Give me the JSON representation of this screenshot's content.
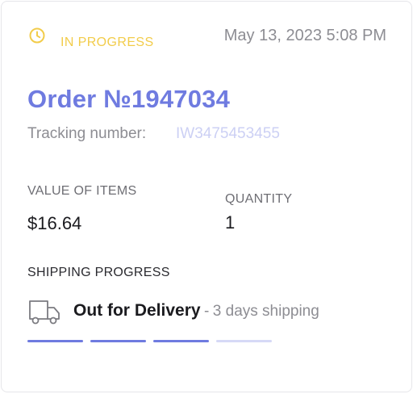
{
  "order": {
    "status": "IN PROGRESS",
    "timestamp": "May 13, 2023 5:08 PM",
    "title": "Order №1947034",
    "tracking_label": "Tracking number:",
    "tracking_number": "IW3475453455"
  },
  "summary": {
    "value_label": "VALUE OF ITEMS",
    "value": "$16.64",
    "quantity_label": "QUANTITY",
    "quantity": "1"
  },
  "shipping": {
    "label": "SHIPPING PROGRESS",
    "status": "Out for Delivery",
    "separator": "-",
    "eta": "3 days shipping",
    "steps": [
      {
        "state": "done"
      },
      {
        "state": "done"
      },
      {
        "state": "done"
      },
      {
        "state": "pending"
      }
    ],
    "completed_steps": 3,
    "total_steps": 4
  },
  "icons": {
    "status": "clock-icon",
    "shipping": "truck-icon"
  },
  "colors": {
    "accent": "#6f7be0",
    "status_warning": "#f2cc4a",
    "muted_text": "#8d8d93",
    "tracking_text": "#ccd0f4",
    "pending_step": "#d6d9f6"
  }
}
